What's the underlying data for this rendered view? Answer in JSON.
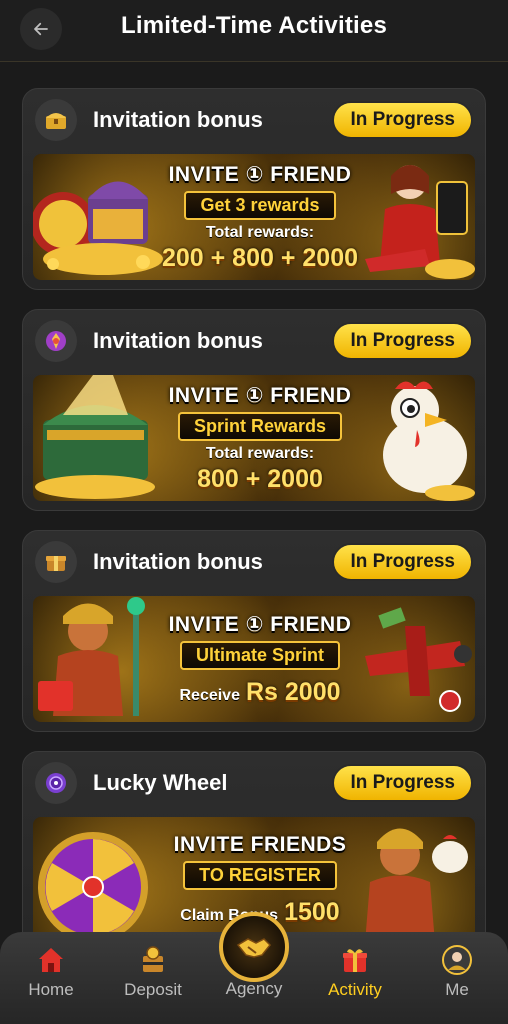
{
  "header": {
    "title": "Limited-Time Activities"
  },
  "cards": [
    {
      "title": "Invitation bonus",
      "status": "In Progress",
      "banner": {
        "headline": "INVITE ① FRIEND",
        "ribbon": "Get 3 rewards",
        "sub": "Total rewards:",
        "big": "200 + 800 + 2000"
      }
    },
    {
      "title": "Invitation bonus",
      "status": "In Progress",
      "banner": {
        "headline": "INVITE ① FRIEND",
        "ribbon": "Sprint Rewards",
        "sub": "Total rewards:",
        "big": "800 + 2000"
      }
    },
    {
      "title": "Invitation bonus",
      "status": "In Progress",
      "banner": {
        "headline": "INVITE ① FRIEND",
        "ribbon": "Ultimate Sprint",
        "sub": "Receive",
        "big": "Rs 2000"
      }
    },
    {
      "title": "Lucky Wheel",
      "status": "In Progress",
      "banner": {
        "headline": "INVITE FRIENDS",
        "ribbon": "TO REGISTER",
        "sub": "Claim Bonus",
        "big": "1500"
      }
    }
  ],
  "nav": {
    "home": "Home",
    "deposit": "Deposit",
    "agency": "Agency",
    "activity": "Activity",
    "me": "Me"
  },
  "colors": {
    "accent": "#ffce1f",
    "background": "#1b1b1b",
    "card": "#2b2b2b"
  }
}
